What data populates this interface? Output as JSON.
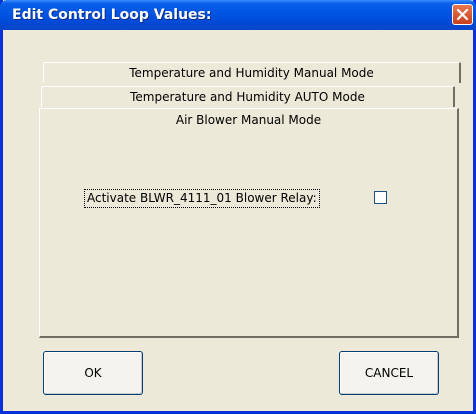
{
  "window": {
    "title": "Edit Control Loop Values:"
  },
  "tabs": [
    {
      "label": "Temperature and Humidity Manual Mode"
    },
    {
      "label": "Temperature and Humidity AUTO Mode"
    },
    {
      "label": "Air Blower Manual Mode"
    }
  ],
  "panel": {
    "relay_label": "Activate BLWR_4111_01 Blower Relay:",
    "relay_checked": false
  },
  "buttons": {
    "ok": "OK",
    "cancel": "CANCEL"
  },
  "colors": {
    "titlebar": "#0054e3",
    "window_bg": "#ece9d8",
    "close_button": "#d9542b"
  },
  "icons": {
    "close": "close-icon"
  }
}
